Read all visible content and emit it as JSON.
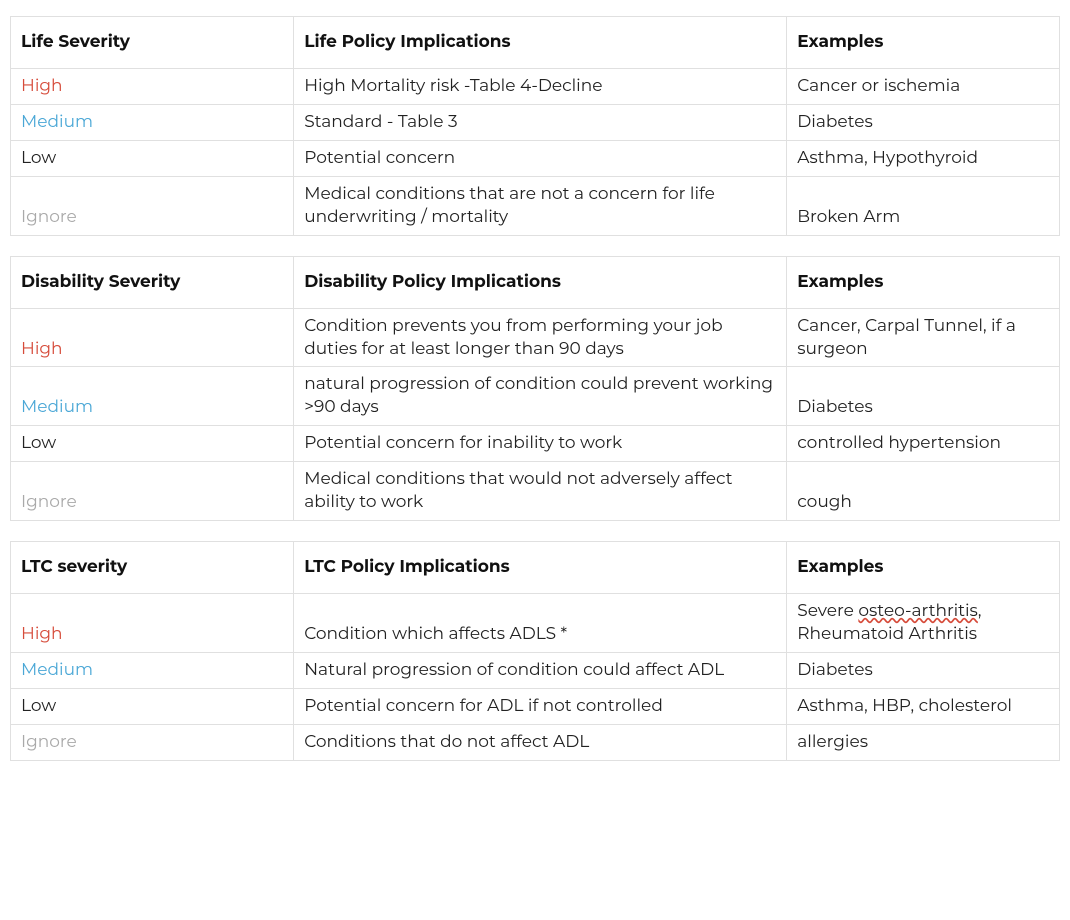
{
  "tables": [
    {
      "headers": [
        "Life Severity",
        "Life Policy Implications",
        "Examples"
      ],
      "rows": [
        {
          "severity": "High",
          "sev_class": "sev-high",
          "implications": "High Mortality risk -Table 4-Decline",
          "examples": "Cancer or ischemia"
        },
        {
          "severity": "Medium",
          "sev_class": "sev-medium",
          "implications": "Standard - Table 3",
          "examples": "Diabetes"
        },
        {
          "severity": "Low",
          "sev_class": "sev-low",
          "implications": "Potential concern",
          "examples": "Asthma, Hypothyroid"
        },
        {
          "severity": "Ignore",
          "sev_class": "sev-ignore",
          "implications": "Medical conditions that are not a concern for life underwriting / mortality",
          "examples": "Broken Arm"
        }
      ]
    },
    {
      "headers": [
        "Disability Severity",
        "Disability Policy Implications",
        "Examples"
      ],
      "rows": [
        {
          "severity": "High",
          "sev_class": "sev-high",
          "implications": "Condition prevents you from performing your job duties for at least longer than 90 days",
          "examples": "Cancer, Carpal Tunnel, if a surgeon"
        },
        {
          "severity": "Medium",
          "sev_class": "sev-medium",
          "implications": "natural progression of condition could prevent working >90 days",
          "examples": "Diabetes"
        },
        {
          "severity": "Low",
          "sev_class": "sev-low",
          "implications": "Potential concern for inability to work",
          "examples": "controlled hypertension"
        },
        {
          "severity": "Ignore",
          "sev_class": "sev-ignore",
          "implications": "Medical conditions that would not adversely affect ability to work",
          "examples": "cough"
        }
      ]
    },
    {
      "headers": [
        "LTC severity",
        "LTC Policy Implications",
        "Examples"
      ],
      "rows": [
        {
          "severity": "High",
          "sev_class": "sev-high",
          "implications": "Condition which affects ADLS *",
          "examples_parts": [
            "Severe ",
            {
              "spell": "osteo-arthritis"
            },
            ", Rheumatoid Arthritis"
          ]
        },
        {
          "severity": "Medium",
          "sev_class": "sev-medium",
          "implications": "Natural progression of condition could affect ADL",
          "examples": "Diabetes"
        },
        {
          "severity": "Low",
          "sev_class": "sev-low",
          "implications": "Potential concern for ADL if not controlled",
          "examples": "Asthma, HBP, cholesterol"
        },
        {
          "severity": "Ignore",
          "sev_class": "sev-ignore",
          "implications": "Conditions that do not affect ADL",
          "examples": "allergies"
        }
      ]
    }
  ]
}
